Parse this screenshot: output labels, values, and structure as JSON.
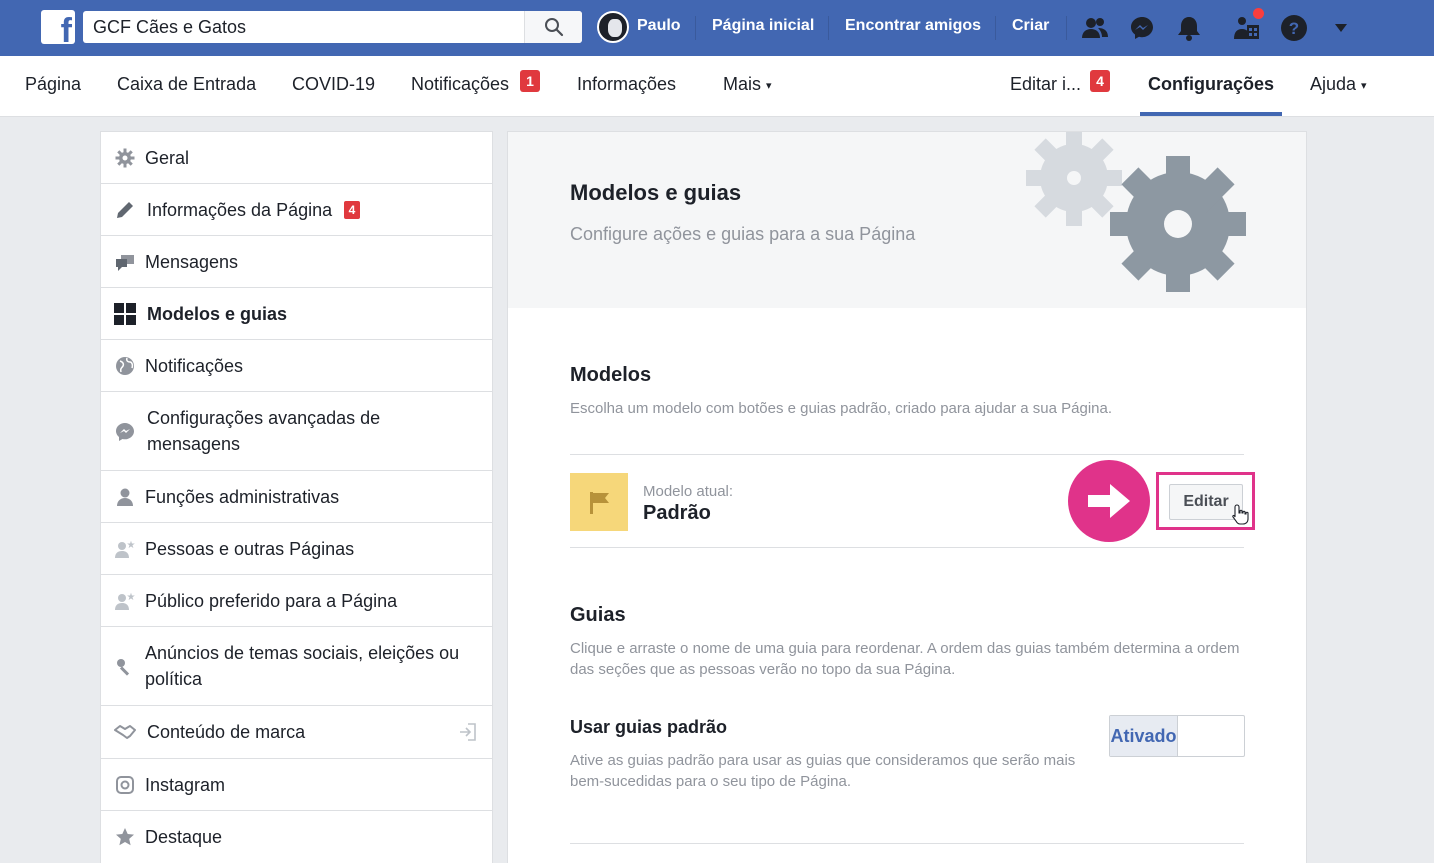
{
  "topbar": {
    "search_value": "GCF Cães e Gatos",
    "user_name": "Paulo",
    "links": [
      "Página inicial",
      "Encontrar amigos",
      "Criar"
    ],
    "icons": [
      "friends-icon",
      "messenger-icon",
      "bell-icon",
      "quick-help-icon",
      "help-icon",
      "caret-down-icon"
    ]
  },
  "tabs": {
    "pagina": "Página",
    "caixa": "Caixa de Entrada",
    "covid": "COVID-19",
    "notificacoes": "Notificações",
    "notificacoes_count": "1",
    "informacoes": "Informações",
    "mais": "Mais",
    "editar": "Editar i...",
    "editar_count": "4",
    "configuracoes": "Configurações",
    "ajuda": "Ajuda"
  },
  "sidebar": {
    "items": [
      {
        "label": "Geral",
        "icon": "gear-icon"
      },
      {
        "label": "Informações da Página",
        "icon": "pencil-icon",
        "badge": "4"
      },
      {
        "label": "Mensagens",
        "icon": "chat-bubbles-icon"
      },
      {
        "label": "Modelos e guias",
        "icon": "grid-icon",
        "active": true
      },
      {
        "label": "Notificações",
        "icon": "globe-icon"
      },
      {
        "label": "Configurações avançadas de mensagens",
        "icon": "messenger-icon"
      },
      {
        "label": "Funções administrativas",
        "icon": "person-icon"
      },
      {
        "label": "Pessoas e outras Páginas",
        "icon": "person-star-icon"
      },
      {
        "label": "Público preferido para a Página",
        "icon": "person-star-icon"
      },
      {
        "label": "Anúncios de temas sociais, eleições ou política",
        "icon": "wrench-icon"
      },
      {
        "label": "Conteúdo de marca",
        "icon": "handshake-icon"
      },
      {
        "label": "Instagram",
        "icon": "instagram-icon"
      },
      {
        "label": "Destaque",
        "icon": "star-icon"
      }
    ]
  },
  "main": {
    "title": "Modelos e guias",
    "subtitle": "Configure ações e guias para a sua Página",
    "modelos": {
      "title": "Modelos",
      "desc": "Escolha um modelo com botões e guias padrão, criado para ajudar a sua Página.",
      "current_label": "Modelo atual:",
      "current_value": "Padrão",
      "edit_button": "Editar"
    },
    "guias": {
      "title": "Guias",
      "desc": "Clique e arraste o nome de uma guia para reordenar. A ordem das guias também determina a ordem das seções que as pessoas verão no topo da sua Página.",
      "default_title": "Usar guias padrão",
      "default_desc": "Ative as guias padrão para usar as guias que consideramos que serão mais bem-sucedidas para o seu tipo de Página.",
      "toggle_label": "Ativado"
    }
  },
  "colors": {
    "fb_blue": "#4267b2",
    "annotation_pink": "#e0338a",
    "badge_red": "#e0393e"
  }
}
